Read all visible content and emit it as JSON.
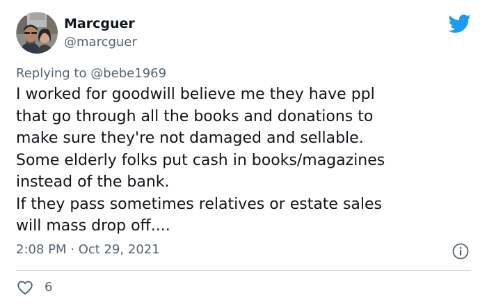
{
  "author": {
    "display_name": "Marcguer",
    "handle": "@marcguer"
  },
  "reply": {
    "prefix": "Replying to",
    "handle": "@bebe1969"
  },
  "tweet": {
    "text": "I worked for goodwill believe me they have ppl\nthat go through all the books and donations to\nmake sure they're not damaged and sellable.\nSome elderly folks put cash in books/magazines\ninstead of the bank.\nIf they pass sometimes relatives or estate sales\nwill mass drop off...."
  },
  "meta": {
    "timestamp": "2:08 PM · Oct 29, 2021"
  },
  "actions": {
    "like_count": "6"
  },
  "icons": {
    "brand": "twitter-bird-icon",
    "info": "info-icon",
    "like": "heart-icon"
  },
  "colors": {
    "brand_blue": "#1d9bf0",
    "text_primary": "#0f1419",
    "text_secondary": "#536471",
    "divider": "#cfd9de"
  }
}
